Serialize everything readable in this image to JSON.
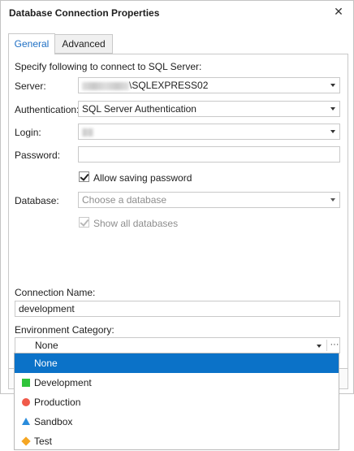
{
  "window": {
    "title": "Database Connection Properties"
  },
  "tabs": [
    {
      "label": "General",
      "active": true
    },
    {
      "label": "Advanced",
      "active": false
    }
  ],
  "general": {
    "intro": "Specify following to connect to SQL Server:",
    "server": {
      "label": "Server:",
      "value_suffix": "\\SQLEXPRESS02"
    },
    "authentication": {
      "label": "Authentication:",
      "value": "SQL Server Authentication"
    },
    "login": {
      "label": "Login:",
      "value": ""
    },
    "password": {
      "label": "Password:",
      "value": ""
    },
    "allow_saving_password": {
      "label": "Allow saving password",
      "checked": true
    },
    "database": {
      "label": "Database:",
      "placeholder": "Choose a database"
    },
    "show_all_databases": {
      "label": "Show all databases",
      "checked": true,
      "disabled": true
    },
    "connection_name": {
      "label": "Connection Name:",
      "value": "development"
    },
    "environment_category": {
      "label": "Environment Category:",
      "selected": "None",
      "options": [
        {
          "label": "None",
          "icon": "none",
          "color": ""
        },
        {
          "label": "Development",
          "icon": "green-square-icon",
          "color": "#2fc43a"
        },
        {
          "label": "Production",
          "icon": "red-circle-icon",
          "color": "#f05a4a"
        },
        {
          "label": "Sandbox",
          "icon": "blue-triangle-icon",
          "color": "#2a8cdc"
        },
        {
          "label": "Test",
          "icon": "orange-diamond-icon",
          "color": "#f5a623"
        }
      ]
    }
  },
  "colors": {
    "accent": "#0b72c8",
    "tab_active_text": "#1e6fc4"
  }
}
